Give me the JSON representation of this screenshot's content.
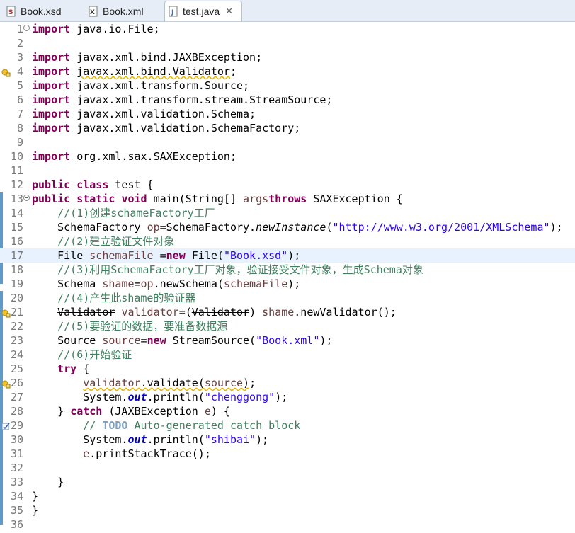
{
  "tabs": [
    {
      "label": "Book.xsd",
      "icon": "xsd-file-icon",
      "active": false
    },
    {
      "label": "Book.xml",
      "icon": "xml-file-icon",
      "active": false
    },
    {
      "label": "test.java",
      "icon": "java-file-icon",
      "active": true
    }
  ],
  "tab_close_glyph": "✕",
  "editor": {
    "current_line": 17,
    "warning_lines": [
      4,
      21,
      26
    ],
    "task_lines": [
      29
    ],
    "lines": [
      {
        "n": "1",
        "folded": true,
        "tokens": [
          [
            "kw",
            "import"
          ],
          [
            "",
            "java.io.File;"
          ]
        ]
      },
      {
        "n": "2",
        "tokens": []
      },
      {
        "n": "3",
        "tokens": [
          [
            "kw",
            "import"
          ],
          [
            "",
            "javax.xml.bind.JAXBException;"
          ]
        ]
      },
      {
        "n": "4",
        "tokens": [
          [
            "kw",
            "import"
          ],
          [
            "warn",
            "javax.xml.bind."
          ],
          [
            "warn strike",
            "Validator"
          ],
          [
            "",
            ";"
          ]
        ]
      },
      {
        "n": "5",
        "tokens": [
          [
            "kw",
            "import"
          ],
          [
            "",
            "javax.xml.transform.Source;"
          ]
        ]
      },
      {
        "n": "6",
        "tokens": [
          [
            "kw",
            "import"
          ],
          [
            "",
            "javax.xml.transform.stream.StreamSource;"
          ]
        ]
      },
      {
        "n": "7",
        "tokens": [
          [
            "kw",
            "import"
          ],
          [
            "",
            "javax.xml.validation.Schema;"
          ]
        ]
      },
      {
        "n": "8",
        "tokens": [
          [
            "kw",
            "import"
          ],
          [
            "",
            "javax.xml.validation.SchemaFactory;"
          ]
        ]
      },
      {
        "n": "9",
        "tokens": []
      },
      {
        "n": "10",
        "tokens": [
          [
            "kw",
            "import"
          ],
          [
            "",
            "org.xml.sax.SAXException;"
          ]
        ]
      },
      {
        "n": "11",
        "tokens": []
      },
      {
        "n": "12",
        "tokens": [
          [
            "kw",
            "public"
          ],
          [
            "",
            ""
          ],
          [
            "kw",
            "class"
          ],
          [
            "",
            " test {"
          ]
        ]
      },
      {
        "n": "13",
        "folded": true,
        "tokens": [
          [
            "kw",
            "public"
          ],
          [
            "",
            ""
          ],
          [
            "kw",
            "static"
          ],
          [
            "",
            ""
          ],
          [
            "kw",
            "void"
          ],
          [
            "",
            " main(String[] "
          ],
          [
            "var",
            "args"
          ],
          [
            ") "
          ],
          [
            "kw",
            "throws"
          ],
          [
            "",
            " SAXException {"
          ]
        ]
      },
      {
        "n": "14",
        "indent": 4,
        "tokens": [
          [
            "cmt",
            "//(1)创建schameFactory工厂"
          ]
        ]
      },
      {
        "n": "15",
        "indent": 4,
        "tokens": [
          [
            "",
            "SchemaFactory "
          ],
          [
            "var",
            "op"
          ],
          [
            "",
            "=SchemaFactory."
          ],
          [
            "it",
            "newInstance"
          ],
          [
            "",
            "("
          ],
          [
            "str",
            "\"http://www.w3.org/2001/XMLSchema\""
          ],
          [
            "",
            ");"
          ]
        ]
      },
      {
        "n": "16",
        "indent": 4,
        "tokens": [
          [
            "cmt",
            "//(2)建立验证文件对象"
          ]
        ]
      },
      {
        "n": "17",
        "indent": 4,
        "tokens": [
          [
            "",
            "File "
          ],
          [
            "var",
            "schemaFile"
          ],
          [
            "",
            " ="
          ],
          [
            "kw",
            "new"
          ],
          [
            "",
            " File("
          ],
          [
            "str",
            "\"Book.xsd\""
          ],
          [
            "",
            ");"
          ]
        ]
      },
      {
        "n": "18",
        "indent": 4,
        "tokens": [
          [
            "cmt",
            "//(3)利用SchemaFactory工厂对象，验证接受文件对象，生成Schema对象"
          ]
        ]
      },
      {
        "n": "19",
        "indent": 4,
        "tokens": [
          [
            "",
            "Schema "
          ],
          [
            "var",
            "shame"
          ],
          [
            "",
            "="
          ],
          [
            "var",
            "op"
          ],
          [
            "",
            ".newSchema("
          ],
          [
            "var",
            "schemaFile"
          ],
          [
            "",
            ");"
          ]
        ]
      },
      {
        "n": "20",
        "indent": 4,
        "tokens": [
          [
            "cmt",
            "//(4)产生此shame的验证器"
          ]
        ]
      },
      {
        "n": "21",
        "indent": 4,
        "tokens": [
          [
            "strike",
            "Validator"
          ],
          [
            "",
            " "
          ],
          [
            "var",
            "validator"
          ],
          [
            "",
            "=("
          ],
          [
            "strike",
            "Validator"
          ],
          [
            "",
            ") "
          ],
          [
            "var",
            "shame"
          ],
          [
            "",
            ".newValidator();"
          ]
        ]
      },
      {
        "n": "22",
        "indent": 4,
        "tokens": [
          [
            "cmt",
            "//(5)要验证的数据，要准备数据源"
          ]
        ]
      },
      {
        "n": "23",
        "indent": 4,
        "tokens": [
          [
            "",
            "Source "
          ],
          [
            "var",
            "source"
          ],
          [
            "",
            "="
          ],
          [
            "kw",
            "new"
          ],
          [
            "",
            " StreamSource("
          ],
          [
            "str",
            "\"Book.xml\""
          ],
          [
            "",
            ");"
          ]
        ]
      },
      {
        "n": "24",
        "indent": 4,
        "tokens": [
          [
            "cmt",
            "//(6)开始验证"
          ]
        ]
      },
      {
        "n": "25",
        "indent": 4,
        "tokens": [
          [
            "kw",
            "try"
          ],
          [
            "",
            " {"
          ]
        ]
      },
      {
        "n": "26",
        "indent": 8,
        "tokens": [
          [
            "var warn",
            "validator"
          ],
          [
            "warn",
            "."
          ],
          [
            "warn strike",
            "validate"
          ],
          [
            "warn",
            "("
          ],
          [
            "var warn",
            "source"
          ],
          [
            "warn",
            ")"
          ],
          [
            "",
            ";"
          ]
        ]
      },
      {
        "n": "27",
        "indent": 8,
        "tokens": [
          [
            "",
            "System."
          ],
          [
            "fld",
            "out"
          ],
          [
            "",
            ".println("
          ],
          [
            "str",
            "\"chenggong\""
          ],
          [
            "",
            ");"
          ]
        ]
      },
      {
        "n": "28",
        "indent": 4,
        "tokens": [
          [
            "",
            "} "
          ],
          [
            "kw",
            "catch"
          ],
          [
            "",
            " (JAXBException "
          ],
          [
            "var",
            "e"
          ],
          [
            "",
            ") {"
          ]
        ]
      },
      {
        "n": "29",
        "indent": 8,
        "tokens": [
          [
            "cmt",
            "// "
          ],
          [
            "todo",
            "TODO"
          ],
          [
            "cmt",
            " Auto-generated catch block"
          ]
        ]
      },
      {
        "n": "30",
        "indent": 8,
        "tokens": [
          [
            "",
            "System."
          ],
          [
            "fld",
            "out"
          ],
          [
            "",
            ".println("
          ],
          [
            "str",
            "\"shibai\""
          ],
          [
            "",
            ");"
          ]
        ]
      },
      {
        "n": "31",
        "indent": 8,
        "tokens": [
          [
            "var",
            "e"
          ],
          [
            "",
            ".printStackTrace();"
          ]
        ]
      },
      {
        "n": "32",
        "tokens": []
      },
      {
        "n": "33",
        "indent": 4,
        "tokens": [
          [
            "",
            "}"
          ]
        ]
      },
      {
        "n": "34",
        "tokens": [
          [
            "",
            "}"
          ]
        ]
      },
      {
        "n": "35",
        "tokens": [
          [
            "",
            "}"
          ]
        ]
      },
      {
        "n": "36",
        "tokens": []
      }
    ]
  },
  "colors": {
    "keyword": "#7f0055",
    "string": "#2a00ff",
    "comment": "#3f7f5f",
    "local_var": "#6a3e3e",
    "static_field": "#0000c0",
    "warning": "#e7b400",
    "current_line_bg": "#e8f2fe",
    "ruler": "#5f9ac9"
  }
}
